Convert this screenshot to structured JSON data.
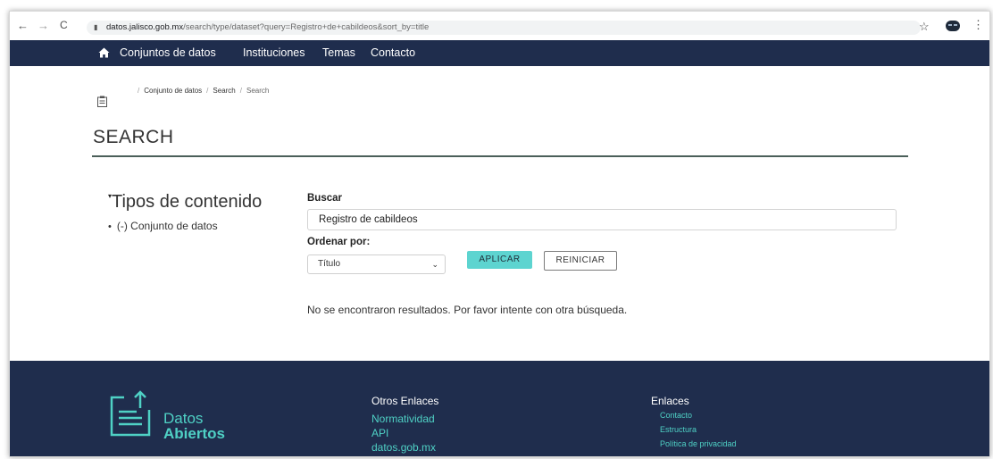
{
  "browser": {
    "back_icon": "←",
    "forward_icon": "→",
    "reload_icon": "C",
    "url_host": "datos.jalisco.gob.mx",
    "url_path": "/search/type/dataset?query=Registro+de+cabildeos&sort_by=title",
    "star_icon": "☆",
    "menu_icon": "⋮"
  },
  "nav": {
    "items": [
      "Conjuntos de datos",
      "Instituciones",
      "Temas",
      "Contacto"
    ]
  },
  "breadcrumb": {
    "items": [
      "Conjunto de datos",
      "Search",
      "Search"
    ],
    "separator": "/"
  },
  "page": {
    "title": "SEARCH"
  },
  "facets": {
    "heading": "Tipos de contenido",
    "caret": "▾",
    "items": [
      "(-) Conjunto de datos"
    ]
  },
  "search": {
    "label": "Buscar",
    "value": "Registro de cabildeos",
    "sort_label": "Ordenar por:",
    "sort_value": "Título",
    "apply_label": "APLICAR",
    "reset_label": "REINICIAR",
    "no_results": "No se encontraron resultados. Por favor intente con otra búsqueda."
  },
  "footer": {
    "logo_line1": "Datos",
    "logo_line2": "Abiertos",
    "col1": {
      "heading": "Otros Enlaces",
      "links": [
        "Normatividad",
        "API",
        "datos.gob.mx"
      ]
    },
    "col2": {
      "heading": "Enlaces",
      "links": [
        "Contacto",
        "Estructura",
        "Política de privacidad"
      ]
    }
  },
  "colors": {
    "navy": "#1f2d4d",
    "teal": "#4fd1c5",
    "apply_button": "#5dd4d0"
  }
}
